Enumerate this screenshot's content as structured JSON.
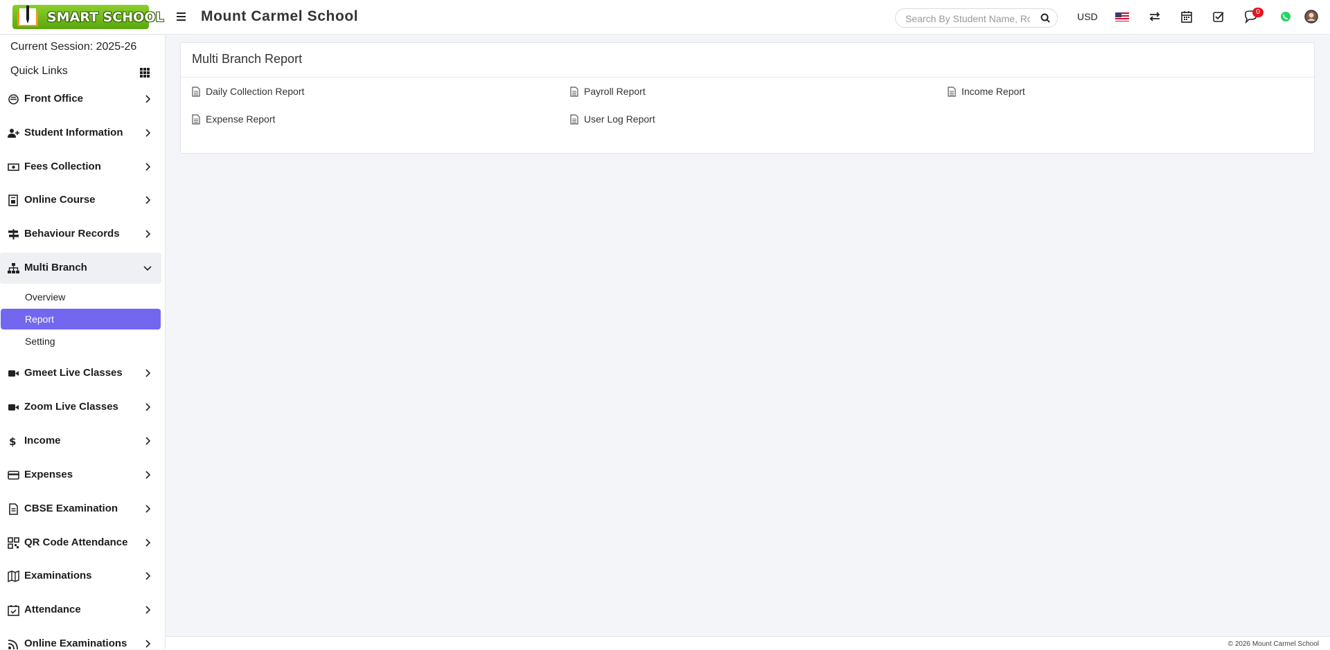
{
  "header": {
    "logo_text": "SMART SCHOOL",
    "school_name": "Mount Carmel School",
    "search_placeholder": "Search By Student Name, Roll Number, Enroll Number, National Id, Local Id Etc.",
    "currency": "USD",
    "chat_badge": "0",
    "icons": [
      "menu-icon",
      "search-icon",
      "us-flag-icon",
      "switch-icon",
      "calendar-icon",
      "task-check-icon",
      "chat-icon",
      "whatsapp-icon",
      "user-avatar-icon"
    ]
  },
  "sidebar": {
    "session": "Current Session: 2025-26",
    "quick_links": "Quick Links",
    "items": [
      {
        "label": "Front Office",
        "icon": "front-office-icon"
      },
      {
        "label": "Student Information",
        "icon": "user-plus-icon"
      },
      {
        "label": "Fees Collection",
        "icon": "money-icon"
      },
      {
        "label": "Online Course",
        "icon": "course-icon"
      },
      {
        "label": "Behaviour Records",
        "icon": "signpost-icon"
      },
      {
        "label": "Multi Branch",
        "icon": "sitemap-icon"
      },
      {
        "label": "Gmeet Live Classes",
        "icon": "video-icon"
      },
      {
        "label": "Zoom Live Classes",
        "icon": "video-icon"
      },
      {
        "label": "Income",
        "icon": "dollar-icon"
      },
      {
        "label": "Expenses",
        "icon": "credit-card-icon"
      },
      {
        "label": "CBSE Examination",
        "icon": "document-icon"
      },
      {
        "label": "QR Code Attendance",
        "icon": "qr-code-icon"
      },
      {
        "label": "Examinations",
        "icon": "map-icon"
      },
      {
        "label": "Attendance",
        "icon": "calendar-check-icon"
      },
      {
        "label": "Online Examinations",
        "icon": "rss-icon"
      }
    ],
    "multi_branch_sub": [
      "Overview",
      "Report",
      "Setting"
    ],
    "active_sub": "Report"
  },
  "main": {
    "panel_title": "Multi Branch Report",
    "reports": [
      "Daily Collection Report",
      "Payroll Report",
      "Income Report",
      "Expense Report",
      "User Log Report"
    ]
  },
  "footer": {
    "copyright": "© 2026 Mount Carmel School"
  },
  "colors": {
    "accent": "#7367f0",
    "logo_green": "#6cb61a",
    "badge_red": "#e3161f",
    "whatsapp": "#25d366"
  }
}
